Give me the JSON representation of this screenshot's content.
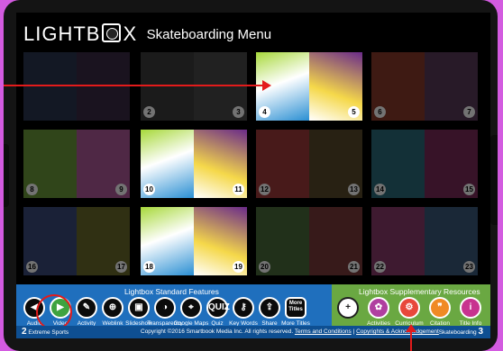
{
  "app": {
    "brand": "LIGHTB",
    "brand_tail": "X",
    "menu_title": "Skateboarding Menu"
  },
  "spreads": [
    {
      "left": "",
      "right": "",
      "left_color": "#2a3550",
      "right_color": "#3a2a45",
      "active": false
    },
    {
      "left": "2",
      "right": "3",
      "left_color": "#3b3b3b",
      "right_color": "#4a4a4a",
      "active": false
    },
    {
      "left": "4",
      "right": "5",
      "left_color": "#ffffff",
      "right_color": "#ffffff",
      "active": true
    },
    {
      "left": "6",
      "right": "7",
      "left_color": "#8a3a2a",
      "right_color": "#5a3a5a",
      "active": false
    },
    {
      "left": "8",
      "right": "9",
      "left_color": "#6a9a3a",
      "right_color": "#b05a9a",
      "active": false
    },
    {
      "left": "10",
      "right": "11",
      "left_color": "#ffffff",
      "right_color": "#ffffff",
      "active": true
    },
    {
      "left": "12",
      "right": "13",
      "left_color": "#a03a3a",
      "right_color": "#5a4a2a",
      "active": false
    },
    {
      "left": "14",
      "right": "15",
      "left_color": "#2a6a7a",
      "right_color": "#7a2a5a",
      "active": false
    },
    {
      "left": "16",
      "right": "17",
      "left_color": "#3a4a7a",
      "right_color": "#6a6a2a",
      "active": false
    },
    {
      "left": "18",
      "right": "19",
      "left_color": "#ffffff",
      "right_color": "#ffffff",
      "active": true
    },
    {
      "left": "20",
      "right": "21",
      "left_color": "#4a6a3a",
      "right_color": "#7a3a3a",
      "active": false
    },
    {
      "left": "22",
      "right": "23",
      "left_color": "#8a3a6a",
      "right_color": "#3a5a7a",
      "active": false
    }
  ],
  "toolbar": {
    "standard_title": "Lightbox Standard Features",
    "supplementary_title": "Lightbox Supplementary Resources",
    "standard": [
      {
        "label": "Audio",
        "glyph": "◀",
        "icon": "audio-icon"
      },
      {
        "label": "Video",
        "glyph": "▶",
        "icon": "play-icon"
      },
      {
        "label": "Activity",
        "glyph": "✎",
        "icon": "activity-icon"
      },
      {
        "label": "Weblink",
        "glyph": "⊕",
        "icon": "globe-icon"
      },
      {
        "label": "Slideshow",
        "glyph": "▣",
        "icon": "slideshow-icon"
      },
      {
        "label": "Transparency",
        "glyph": "◑",
        "icon": "transparency-icon"
      },
      {
        "label": "Google Maps",
        "glyph": "⌖",
        "icon": "maps-icon"
      },
      {
        "label": "Quiz",
        "glyph": "QUIZ",
        "icon": "quiz-icon"
      },
      {
        "label": "Key Words",
        "glyph": "⚷",
        "icon": "key-icon"
      },
      {
        "label": "Share",
        "glyph": "⇪",
        "icon": "share-icon"
      },
      {
        "label": "More Titles",
        "glyph": "More Titles",
        "icon": "more-titles-icon"
      }
    ],
    "supplementary": [
      {
        "label": "",
        "glyph": "+",
        "icon": "plus-icon",
        "color": "#ffffff"
      },
      {
        "label": "Activities",
        "glyph": "✿",
        "icon": "activities-icon",
        "color": "#b03fa0"
      },
      {
        "label": "Curriculum",
        "glyph": "⚙",
        "icon": "curriculum-icon",
        "color": "#e8483b"
      },
      {
        "label": "Citation",
        "glyph": "❞",
        "icon": "citation-icon",
        "color": "#f08a24"
      },
      {
        "label": "Title Info",
        "glyph": "i",
        "icon": "info-icon",
        "color": "#c8338f"
      }
    ]
  },
  "footer": {
    "left_num": "2",
    "left_text": "Extreme Sports",
    "copyright": "Copyright ©2016 Smartbook Media Inc. All rights reserved.",
    "terms": "Terms and Conditions",
    "copyrights_link": "Copyrights & Acknowledgement",
    "right_text": "Skateboarding",
    "right_num": "3"
  },
  "colors": {
    "bg": "#d35be0",
    "toolbar": "#1f6fbd",
    "supplementary": "#6aa842",
    "highlight": "#e31b1b"
  }
}
